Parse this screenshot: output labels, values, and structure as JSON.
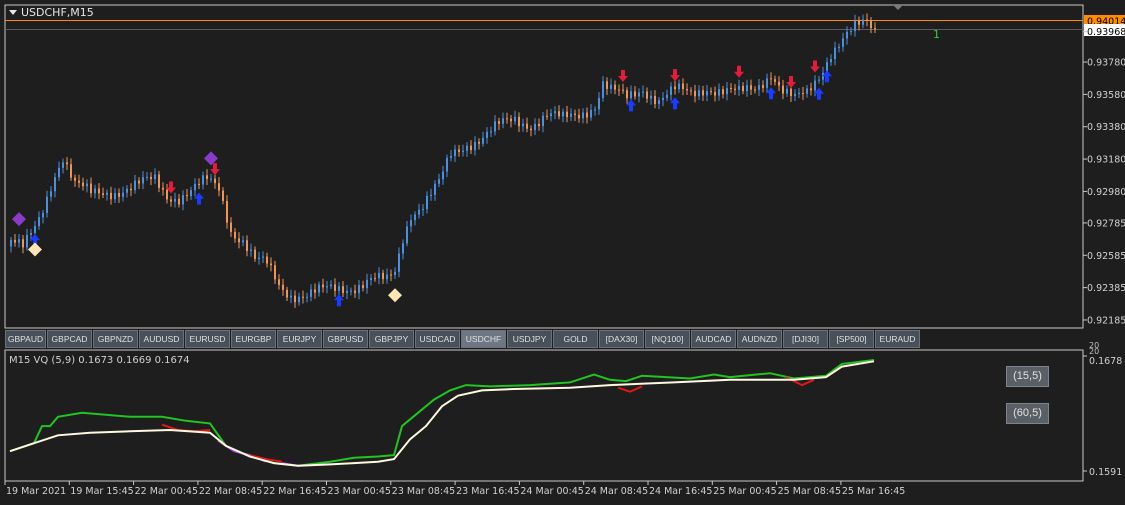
{
  "window": {
    "title": "USDCHF,M15"
  },
  "colors": {
    "background": "#1e1e1e",
    "panel_border": "#c8c8c8",
    "candle_up": "#4a90e2",
    "candle_down": "#f0955a",
    "current_price_line": "#ff8c00",
    "arrow_buy": "#1a3cff",
    "arrow_sell": "#e01e3c",
    "diamond_purple": "#8a3cc8",
    "diamond_cream": "#ffe4b4",
    "vq_green": "#22c422",
    "vq_red": "#e01818",
    "vq_purple": "#b040e0",
    "vq_white": "#fff8e0",
    "button_bg": "#48505a",
    "button_active_bg": "#6e7884"
  },
  "price_axis": {
    "labels": [
      "0.93968",
      "0.93780",
      "0.93580",
      "0.93380",
      "0.93180",
      "0.92980",
      "0.92785",
      "0.92585",
      "0.92385",
      "0.92185"
    ],
    "current_price": "0.94014",
    "marker_text": "1"
  },
  "symbol_bar": {
    "buttons": [
      "GBPAUD",
      "GBPCAD",
      "GBPNZD",
      "AUDUSD",
      "EURUSD",
      "EURGBP",
      "EURJPY",
      "GBPUSD",
      "GBPJPY",
      "USDCAD",
      "USDCHF",
      "USDJPY",
      "GOLD",
      "[DAX30]",
      "[NQ100]",
      "AUDCAD",
      "AUDNZD",
      "[DJI30]",
      "[SP500]",
      "EURAUD"
    ],
    "active": "USDCHF"
  },
  "indicator": {
    "label": "M15 VQ (5,9) 0.1673 0.1669 0.1674",
    "axis_top": "0.1678",
    "axis_bottom": "0.1591",
    "axis_small_top": "20",
    "axis_small_bottom": "20",
    "buttons": [
      "(15,5)",
      "(60,5)"
    ]
  },
  "time_axis": {
    "labels": [
      "19 Mar 2021",
      "19 Mar 15:45",
      "22 Mar 00:45",
      "22 Mar 08:45",
      "22 Mar 16:45",
      "23 Mar 00:45",
      "23 Mar 08:45",
      "23 Mar 16:45",
      "24 Mar 00:45",
      "24 Mar 08:45",
      "24 Mar 16:45",
      "25 Mar 00:45",
      "25 Mar 08:45",
      "25 Mar 16:45"
    ]
  },
  "chart_data": {
    "type": "candlestick",
    "symbol": "USDCHF",
    "timeframe": "M15",
    "ylim": [
      0.9216,
      0.9404
    ],
    "close_anchors": [
      [
        0,
        0.9268
      ],
      [
        3,
        0.9262
      ],
      [
        5,
        0.927
      ],
      [
        7,
        0.928
      ],
      [
        9,
        0.9295
      ],
      [
        11,
        0.931
      ],
      [
        13,
        0.932
      ],
      [
        16,
        0.9302
      ],
      [
        20,
        0.9296
      ],
      [
        24,
        0.9298
      ],
      [
        30,
        0.93
      ],
      [
        36,
        0.9305
      ],
      [
        39,
        0.9296
      ],
      [
        42,
        0.9295
      ],
      [
        45,
        0.9298
      ],
      [
        49,
        0.9304
      ],
      [
        52,
        0.93
      ],
      [
        55,
        0.9275
      ],
      [
        58,
        0.9268
      ],
      [
        61,
        0.9255
      ],
      [
        64,
        0.9252
      ],
      [
        67,
        0.924
      ],
      [
        70,
        0.9235
      ],
      [
        74,
        0.9234
      ],
      [
        78,
        0.9236
      ],
      [
        82,
        0.9238
      ],
      [
        86,
        0.924
      ],
      [
        90,
        0.9243
      ],
      [
        94,
        0.9242
      ],
      [
        96,
        0.9248
      ],
      [
        98,
        0.927
      ],
      [
        100,
        0.9285
      ],
      [
        103,
        0.929
      ],
      [
        107,
        0.9302
      ],
      [
        110,
        0.932
      ],
      [
        114,
        0.9328
      ],
      [
        118,
        0.9332
      ],
      [
        122,
        0.9338
      ],
      [
        126,
        0.9342
      ],
      [
        130,
        0.934
      ],
      [
        134,
        0.9345
      ],
      [
        138,
        0.9342
      ],
      [
        142,
        0.9346
      ],
      [
        146,
        0.9352
      ],
      [
        148,
        0.9365
      ],
      [
        150,
        0.936
      ],
      [
        154,
        0.9355
      ],
      [
        158,
        0.9362
      ],
      [
        162,
        0.9355
      ],
      [
        166,
        0.936
      ],
      [
        170,
        0.9358
      ],
      [
        174,
        0.9363
      ],
      [
        178,
        0.936
      ],
      [
        182,
        0.9358
      ],
      [
        186,
        0.9362
      ],
      [
        190,
        0.9372
      ],
      [
        193,
        0.936
      ],
      [
        196,
        0.9354
      ],
      [
        199,
        0.9358
      ],
      [
        202,
        0.937
      ],
      [
        205,
        0.9385
      ],
      [
        208,
        0.9392
      ],
      [
        211,
        0.9398
      ],
      [
        214,
        0.9402
      ],
      [
        216,
        0.9398
      ]
    ],
    "buy_arrows": [
      6,
      47,
      82,
      155,
      166,
      190,
      202,
      204
    ],
    "sell_arrows": [
      40,
      51,
      153,
      166,
      182,
      195,
      201
    ],
    "purple_diamonds": [
      2,
      50
    ],
    "cream_diamonds": [
      6,
      96
    ],
    "vq_white": [
      [
        0,
        0.1606
      ],
      [
        6,
        0.1612
      ],
      [
        12,
        0.1618
      ],
      [
        20,
        0.162
      ],
      [
        30,
        0.1621
      ],
      [
        40,
        0.1622
      ],
      [
        50,
        0.162
      ],
      [
        54,
        0.161
      ],
      [
        60,
        0.1602
      ],
      [
        66,
        0.1597
      ],
      [
        72,
        0.1595
      ],
      [
        80,
        0.1596
      ],
      [
        86,
        0.1597
      ],
      [
        92,
        0.1598
      ],
      [
        96,
        0.16
      ],
      [
        100,
        0.1615
      ],
      [
        104,
        0.1625
      ],
      [
        108,
        0.164
      ],
      [
        112,
        0.1648
      ],
      [
        118,
        0.1652
      ],
      [
        126,
        0.1653
      ],
      [
        140,
        0.1654
      ],
      [
        150,
        0.1656
      ],
      [
        166,
        0.1658
      ],
      [
        180,
        0.166
      ],
      [
        196,
        0.166
      ],
      [
        204,
        0.1662
      ],
      [
        208,
        0.167
      ],
      [
        216,
        0.1674
      ]
    ],
    "vq_green": [
      [
        0,
        0.1606
      ],
      [
        6,
        0.1612
      ],
      [
        8,
        0.1625
      ],
      [
        10,
        0.1625
      ],
      [
        12,
        0.1632
      ],
      [
        18,
        0.1635
      ],
      [
        30,
        0.1632
      ],
      [
        38,
        0.1632
      ],
      [
        44,
        0.1629
      ],
      [
        50,
        0.1627
      ],
      [
        54,
        0.161
      ],
      [
        60,
        0.1602
      ],
      [
        66,
        0.1597
      ],
      [
        72,
        0.1595
      ],
      [
        80,
        0.1598
      ],
      [
        86,
        0.1601
      ],
      [
        92,
        0.1602
      ],
      [
        96,
        0.1603
      ],
      [
        98,
        0.1625
      ],
      [
        102,
        0.1635
      ],
      [
        106,
        0.1645
      ],
      [
        110,
        0.1652
      ],
      [
        114,
        0.1656
      ],
      [
        120,
        0.1655
      ],
      [
        130,
        0.1656
      ],
      [
        140,
        0.1658
      ],
      [
        146,
        0.1664
      ],
      [
        150,
        0.166
      ],
      [
        154,
        0.1659
      ],
      [
        158,
        0.1663
      ],
      [
        164,
        0.1662
      ],
      [
        170,
        0.1661
      ],
      [
        176,
        0.1664
      ],
      [
        180,
        0.1662
      ],
      [
        190,
        0.1665
      ],
      [
        196,
        0.1661
      ],
      [
        204,
        0.1663
      ],
      [
        208,
        0.1672
      ],
      [
        216,
        0.1675
      ]
    ]
  }
}
